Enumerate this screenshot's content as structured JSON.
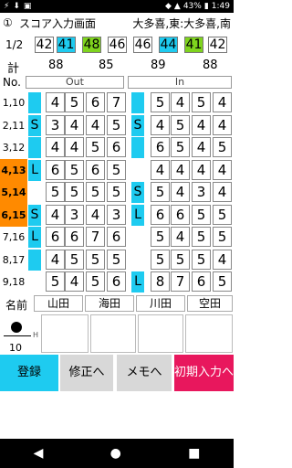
{
  "status": {
    "left_icons": [
      "⚡",
      "⬇",
      "▣"
    ],
    "battery": "43%",
    "time": "1:49"
  },
  "title": {
    "num": "①",
    "text": "スコア入力画面",
    "right": "大多喜,東:大多喜,南"
  },
  "half_row": {
    "label": "1/2",
    "boxes": [
      {
        "v": "42",
        "color": "#fff"
      },
      {
        "v": "41",
        "color": "#1ecbf0"
      },
      {
        "v": "48",
        "color": "#7fd41e"
      },
      {
        "v": "46",
        "color": "#fff"
      },
      {
        "v": "46",
        "color": "#fff"
      },
      {
        "v": "44",
        "color": "#1ecbf0"
      },
      {
        "v": "41",
        "color": "#7fd41e"
      },
      {
        "v": "42",
        "color": "#fff"
      }
    ]
  },
  "totals": {
    "label": "計",
    "values": [
      "88",
      "85",
      "89",
      "88"
    ]
  },
  "header": {
    "no": "No.",
    "out": "Out",
    "in": "In"
  },
  "holes": [
    {
      "no": "1,10",
      "hl": false,
      "m1": "",
      "m1c": true,
      "a": [
        "4",
        "5",
        "6",
        "7"
      ],
      "m2": "",
      "m2c": true,
      "b": [
        "5",
        "4",
        "5",
        "4"
      ]
    },
    {
      "no": "2,11",
      "hl": false,
      "m1": "S",
      "m1c": true,
      "a": [
        "3",
        "4",
        "4",
        "5"
      ],
      "m2": "S",
      "m2c": true,
      "b": [
        "4",
        "5",
        "4",
        "4"
      ]
    },
    {
      "no": "3,12",
      "hl": false,
      "m1": "",
      "m1c": true,
      "a": [
        "4",
        "4",
        "5",
        "6"
      ],
      "m2": "",
      "m2c": true,
      "b": [
        "6",
        "5",
        "4",
        "5"
      ]
    },
    {
      "no": "4,13",
      "hl": true,
      "m1": "L",
      "m1c": true,
      "a": [
        "6",
        "5",
        "6",
        "5"
      ],
      "m2": "",
      "m2c": false,
      "b": [
        "4",
        "4",
        "4",
        "4"
      ]
    },
    {
      "no": "5,14",
      "hl": true,
      "m1": "",
      "m1c": false,
      "a": [
        "5",
        "5",
        "5",
        "5"
      ],
      "m2": "S",
      "m2c": true,
      "b": [
        "5",
        "4",
        "3",
        "4"
      ]
    },
    {
      "no": "6,15",
      "hl": true,
      "m1": "S",
      "m1c": true,
      "a": [
        "4",
        "3",
        "4",
        "3"
      ],
      "m2": "L",
      "m2c": true,
      "b": [
        "6",
        "6",
        "5",
        "5"
      ]
    },
    {
      "no": "7,16",
      "hl": false,
      "m1": "L",
      "m1c": true,
      "a": [
        "6",
        "6",
        "7",
        "6"
      ],
      "m2": "",
      "m2c": false,
      "b": [
        "5",
        "4",
        "5",
        "5"
      ]
    },
    {
      "no": "8,17",
      "hl": false,
      "m1": "",
      "m1c": true,
      "a": [
        "4",
        "5",
        "5",
        "5"
      ],
      "m2": "",
      "m2c": false,
      "b": [
        "5",
        "5",
        "5",
        "4"
      ]
    },
    {
      "no": "9,18",
      "hl": false,
      "m1": "",
      "m1c": false,
      "a": [
        "5",
        "4",
        "5",
        "6"
      ],
      "m2": "L",
      "m2c": true,
      "b": [
        "8",
        "7",
        "6",
        "5"
      ]
    }
  ],
  "names": {
    "label": "名前",
    "players": [
      "山田",
      "海田",
      "川田",
      "空田"
    ]
  },
  "pen": {
    "size": "10",
    "hint": "H"
  },
  "buttons": [
    {
      "label": "登録",
      "color": "#1ecbf0",
      "fg": "#000"
    },
    {
      "label": "修正へ",
      "color": "#d8d8d8",
      "fg": "#000"
    },
    {
      "label": "メモへ",
      "color": "#d8d8d8",
      "fg": "#000"
    },
    {
      "label": "初期入力へ",
      "color": "#e8175d",
      "fg": "#fff"
    }
  ],
  "nav": [
    "◀",
    "●",
    "■"
  ]
}
